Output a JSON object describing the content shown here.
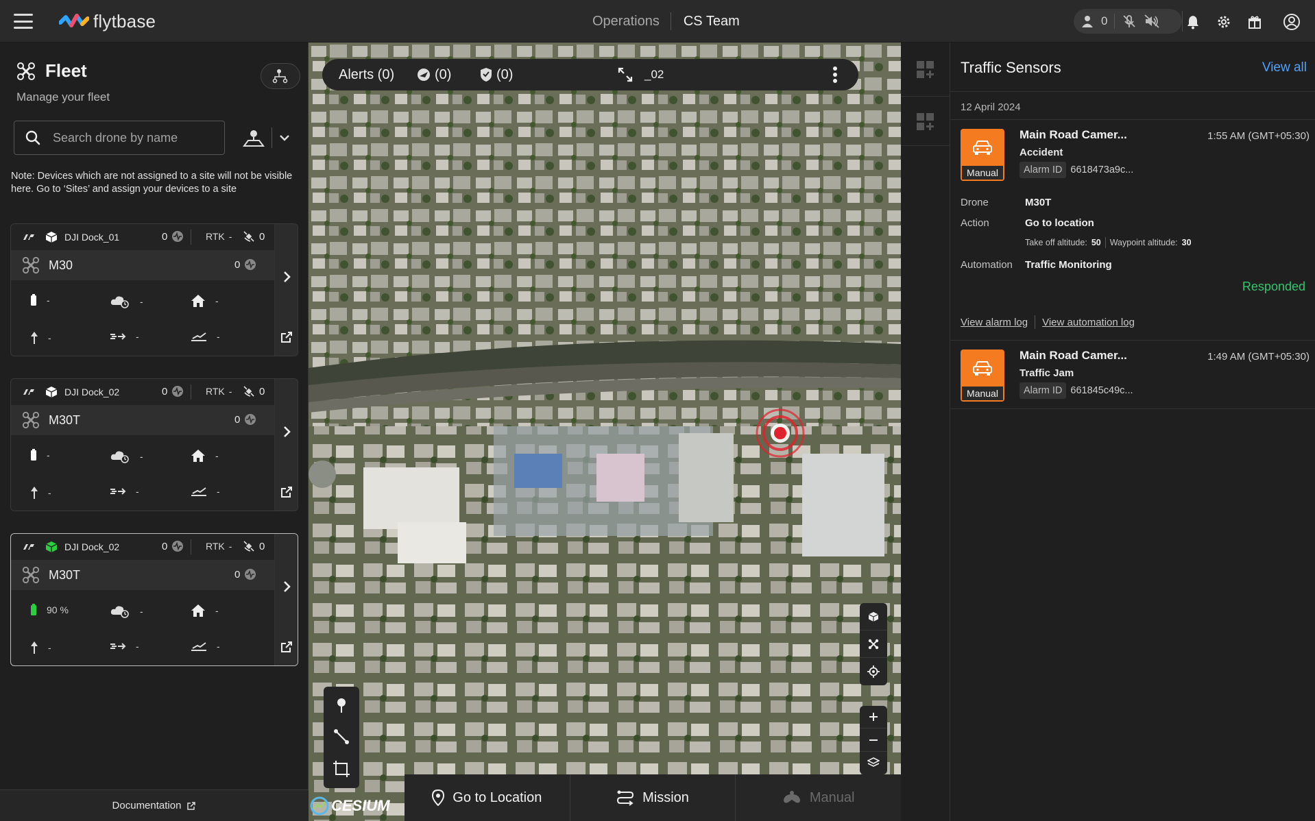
{
  "topbar": {
    "logo_text": "flytbase",
    "nav_operations": "Operations",
    "nav_team": "CS Team",
    "user_count": "0"
  },
  "fleet": {
    "title": "Fleet",
    "subtitle": "Manage your fleet",
    "search_placeholder": "Search drone by name",
    "note": "Note: Devices which are not assigned to a site will not be visible here. Go to ‘Sites’ and assign your devices to a site",
    "docks": [
      {
        "dock_name": "DJI Dock_01",
        "alert_count": "0",
        "rtk_label": "RTK",
        "rtk_value": "-",
        "sat_count": "0",
        "drone_name": "M30",
        "drone_alert_count": "0",
        "battery": "-",
        "weather": "-",
        "home": "-",
        "altitude": "-",
        "speed": "-",
        "distance": "-",
        "dock_status_color": "#ffffff",
        "battery_color": "#ffffff"
      },
      {
        "dock_name": "DJI Dock_02",
        "alert_count": "0",
        "rtk_label": "RTK",
        "rtk_value": "-",
        "sat_count": "0",
        "drone_name": "M30T",
        "drone_alert_count": "0",
        "battery": "-",
        "weather": "-",
        "home": "-",
        "altitude": "-",
        "speed": "-",
        "distance": "-",
        "dock_status_color": "#ffffff",
        "battery_color": "#ffffff"
      },
      {
        "dock_name": "DJI Dock_02",
        "alert_count": "0",
        "rtk_label": "RTK",
        "rtk_value": "-",
        "sat_count": "0",
        "drone_name": "M30T",
        "drone_alert_count": "0",
        "battery": "90 %",
        "weather": "-",
        "home": "-",
        "altitude": "-",
        "speed": "-",
        "distance": "-",
        "dock_status_color": "#2ecc40",
        "battery_color": "#2ecc40"
      }
    ],
    "documentation_label": "Documentation"
  },
  "map": {
    "alerts_label": "Alerts (0)",
    "airspace_count": "(0)",
    "shield_count": "(0)",
    "dock_suffix": "_02",
    "cesium_label": "CESIUM",
    "actions": [
      {
        "label": "Go to Location",
        "icon": "location-pin-icon"
      },
      {
        "label": "Mission",
        "icon": "route-icon"
      },
      {
        "label": "Manual",
        "icon": "joystick-icon"
      }
    ]
  },
  "traffic": {
    "title": "Traffic Sensors",
    "view_all": "View all",
    "date": "12 April 2024",
    "alarms": [
      {
        "title": "Main Road Camer...",
        "time": "1:55 AM (GMT+05:30)",
        "type": "Accident",
        "badge": "Manual",
        "alarm_id_label": "Alarm ID",
        "alarm_id": "6618473a9c...",
        "drone_label": "Drone",
        "drone": "M30T",
        "action_label": "Action",
        "action": "Go to location",
        "takeoff_label": "Take off altitude:",
        "takeoff": "50",
        "waypoint_label": "Waypoint altitude:",
        "waypoint": "30",
        "automation_label": "Automation",
        "automation": "Traffic Monitoring",
        "status": "Responded",
        "view_alarm_log": "View alarm log",
        "view_automation_log": "View automation log"
      },
      {
        "title": "Main Road Camer...",
        "time": "1:49 AM (GMT+05:30)",
        "type": "Traffic Jam",
        "badge": "Manual",
        "alarm_id_label": "Alarm ID",
        "alarm_id": "661845c49c..."
      }
    ]
  },
  "colors": {
    "accent_orange": "#f47b20",
    "link_blue": "#4ea3ff",
    "success_green": "#35c46d"
  }
}
